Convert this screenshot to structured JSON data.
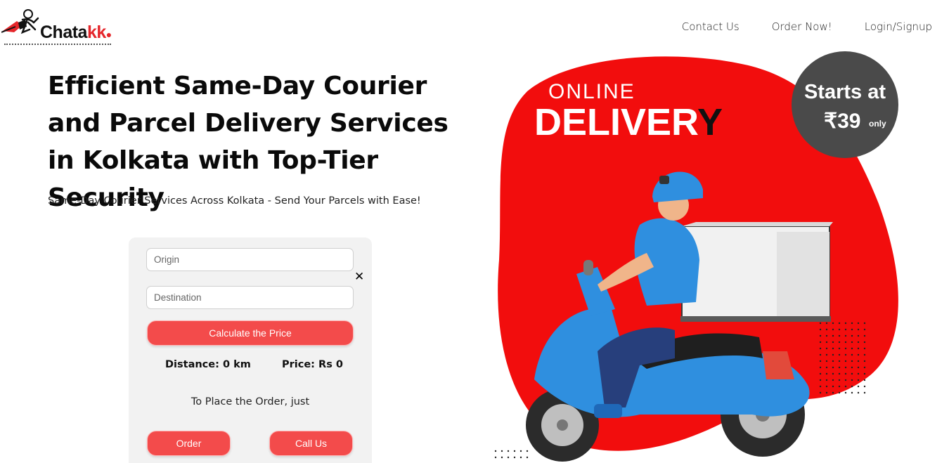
{
  "brand": {
    "name_main": "Chata",
    "name_accent": "kk"
  },
  "nav": {
    "contact": "Contact Us",
    "order": "Order Now!",
    "login": "Login/Signup"
  },
  "hero": {
    "title": "Efficient Same-Day Courier and Parcel Delivery Services in Kolkata with Top-Tier Security",
    "subtitle": "Same-Day Courier Services Across Kolkata - Send Your Parcels with Ease!"
  },
  "form": {
    "origin_placeholder": "Origin",
    "origin_value": "",
    "destination_placeholder": "Destination",
    "destination_value": "",
    "close_label": "✕",
    "calculate_label": "Calculate the Price",
    "distance_label": "Distance: 0 km",
    "price_label": "Price: Rs 0",
    "place_order_text": "To Place the Order, just",
    "order_label": "Order",
    "call_label": "Call Us"
  },
  "banner": {
    "line1": "ONLINE",
    "line2_white": "DELIVER",
    "line2_dark": "Y",
    "badge_line1": "Starts at",
    "badge_price": "₹39",
    "badge_suffix": "only"
  },
  "colors": {
    "accent_red": "#f34b4b",
    "banner_red": "#f20d0d",
    "badge_gray": "#4a4a4a",
    "scooter_blue": "#2f8fdf"
  }
}
